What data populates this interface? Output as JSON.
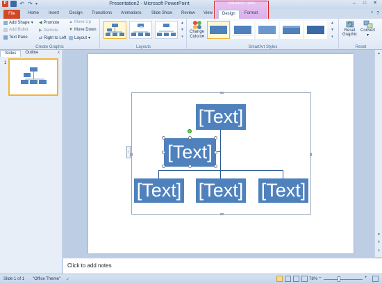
{
  "title_bar": {
    "app_title": "Presentation2 - Microsoft PowerPoint",
    "contextual_group": "SmartArt Tools",
    "qat_icons": [
      "powerpoint-logo",
      "save",
      "undo",
      "redo",
      "customize"
    ],
    "window_controls": [
      "–",
      "□",
      "✕"
    ]
  },
  "tabs": {
    "file": "File",
    "items": [
      "Home",
      "Insert",
      "Design",
      "Transitions",
      "Animations",
      "Slide Show",
      "Review",
      "View"
    ],
    "contextual": [
      "Design",
      "Format"
    ],
    "help_icons": [
      "^",
      "?"
    ]
  },
  "ribbon": {
    "create_graphic": {
      "label": "Create Graphic",
      "add_shape": "Add Shape",
      "add_bullet": "Add Bullet",
      "text_pane": "Text Pane",
      "promote": "Promote",
      "demote": "Demote",
      "right_to_left": "Right to Left",
      "move_up": "Move Up",
      "move_down": "Move Down",
      "layout": "Layout"
    },
    "layouts": {
      "label": "Layouts"
    },
    "smartart_styles": {
      "label": "SmartArt Styles",
      "change_colors_1": "Change",
      "change_colors_2": "Colors"
    },
    "reset": {
      "label": "Reset",
      "reset_graphic_1": "Reset",
      "reset_graphic_2": "Graphic",
      "convert": "Convert"
    }
  },
  "left_panel": {
    "tabs": [
      "Slides",
      "Outline"
    ],
    "close": "x",
    "slide_number": "1"
  },
  "slide": {
    "boxes": {
      "top": "[Text]",
      "assistant": "[Text]",
      "bottom_left": "[Text]",
      "bottom_middle": "[Text]",
      "bottom_right": "[Text]"
    },
    "accent_color": "#4f81bd"
  },
  "notes": {
    "placeholder": "Click to add notes"
  },
  "status_bar": {
    "slide_info": "Slide 1 of 1",
    "theme": "\"Office Theme\"",
    "zoom": "78%",
    "zoom_minus": "–",
    "zoom_plus": "+"
  }
}
